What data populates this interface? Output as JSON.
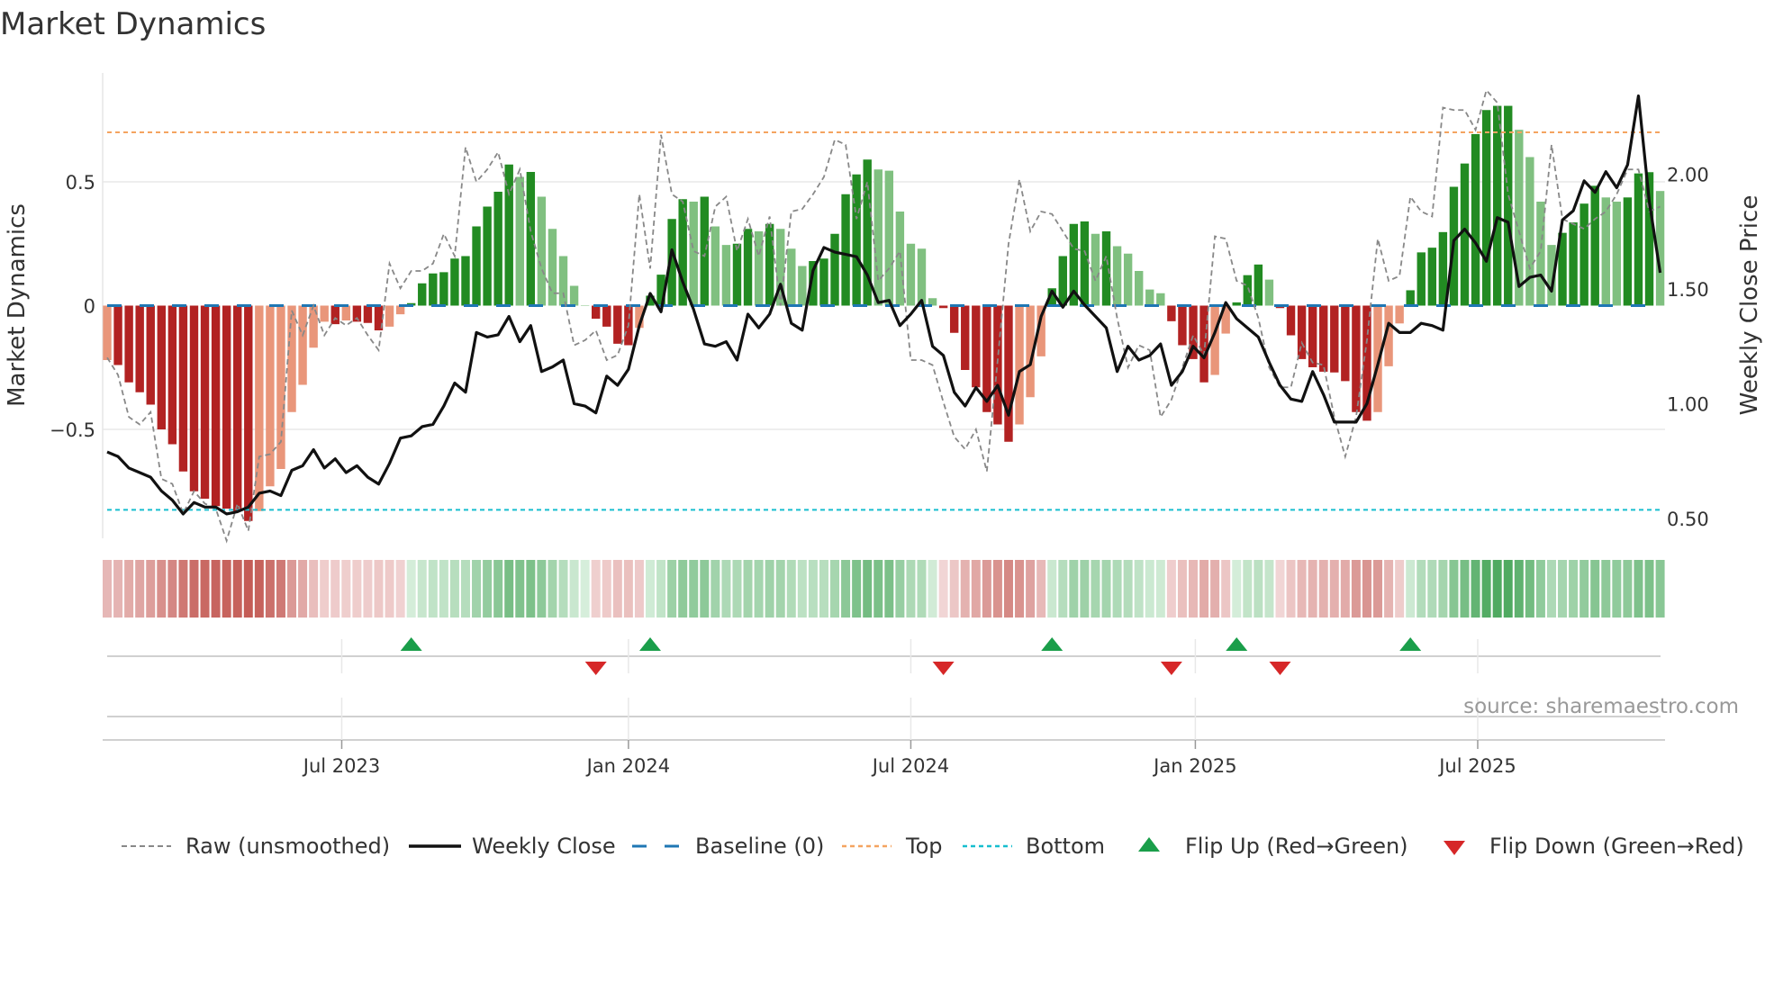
{
  "title": "Market Dynamics",
  "source": "source: sharemaestro.com",
  "colors": {
    "falling_negative": "#b22222",
    "rising_negative": "#e9967a",
    "rising_positive": "#228b22",
    "falling_positive": "#80c080",
    "raw_line": "#888888",
    "close_line": "#111111",
    "baseline": "#1f77b4",
    "top": "#f4a460",
    "bottom": "#17becf",
    "flip_up": "#1a9e4a",
    "flip_down": "#d62728"
  },
  "chart_data": {
    "type": "bar",
    "title": "Market Dynamics",
    "ylabel": "Market Dynamics",
    "y2label": "Weekly Close Price",
    "ylim": [
      -0.94,
      0.94
    ],
    "y2lim": [
      0.414,
      2.44
    ],
    "yticks": [
      {
        "value": 0.5,
        "label": "0.5"
      },
      {
        "value": 0,
        "label": "0"
      },
      {
        "value": -0.5,
        "label": "−0.5"
      }
    ],
    "y2ticks": [
      {
        "value": 2.0,
        "label": "2.00"
      },
      {
        "value": 1.5,
        "label": "1.50"
      },
      {
        "value": 1.0,
        "label": "1.00"
      },
      {
        "value": 0.5,
        "label": "0.50"
      }
    ],
    "xticks": [
      {
        "week": 21.6,
        "label": "Jul 2023"
      },
      {
        "week": 48.0,
        "label": "Jan 2024"
      },
      {
        "week": 74.0,
        "label": "Jul 2024"
      },
      {
        "week": 100.2,
        "label": "Jan 2025"
      },
      {
        "week": 126.2,
        "label": "Jul 2025"
      }
    ],
    "top_level": 0.7,
    "bottom_level": -0.825,
    "baseline": 0,
    "dynamics": [
      -0.22,
      -0.24,
      -0.31,
      -0.35,
      -0.4,
      -0.5,
      -0.56,
      -0.67,
      -0.75,
      -0.78,
      -0.81,
      -0.82,
      -0.83,
      -0.87,
      -0.83,
      -0.73,
      -0.66,
      -0.43,
      -0.32,
      -0.17,
      -0.065,
      -0.075,
      -0.06,
      -0.065,
      -0.07,
      -0.1,
      -0.085,
      -0.035,
      0.01,
      0.09,
      0.13,
      0.135,
      0.19,
      0.2,
      0.32,
      0.4,
      0.46,
      0.57,
      0.52,
      0.54,
      0.44,
      0.31,
      0.2,
      0.08,
      0.0,
      -0.053,
      -0.085,
      -0.154,
      -0.16,
      -0.09,
      0.04,
      0.125,
      0.35,
      0.43,
      0.42,
      0.44,
      0.32,
      0.245,
      0.25,
      0.31,
      0.3,
      0.33,
      0.31,
      0.23,
      0.16,
      0.18,
      0.19,
      0.29,
      0.45,
      0.53,
      0.59,
      0.55,
      0.545,
      0.38,
      0.25,
      0.23,
      0.03,
      -0.01,
      -0.11,
      -0.26,
      -0.33,
      -0.43,
      -0.48,
      -0.55,
      -0.48,
      -0.37,
      -0.205,
      0.07,
      0.2,
      0.33,
      0.34,
      0.29,
      0.3,
      0.24,
      0.21,
      0.14,
      0.065,
      0.05,
      -0.063,
      -0.16,
      -0.216,
      -0.31,
      -0.28,
      -0.113,
      0.013,
      0.123,
      0.166,
      0.105,
      -0.01,
      -0.12,
      -0.216,
      -0.249,
      -0.267,
      -0.27,
      -0.305,
      -0.43,
      -0.465,
      -0.43,
      -0.245,
      -0.072,
      0.062,
      0.215,
      0.234,
      0.297,
      0.48,
      0.574,
      0.693,
      0.79,
      0.807,
      0.807,
      0.71,
      0.6,
      0.42,
      0.245,
      0.294,
      0.336,
      0.412,
      0.484,
      0.437,
      0.42,
      0.437,
      0.534,
      0.539,
      0.463
    ],
    "raw": [
      -0.21,
      -0.28,
      -0.45,
      -0.48,
      -0.43,
      -0.7,
      -0.72,
      -0.84,
      -0.75,
      -0.8,
      -0.82,
      -0.95,
      -0.8,
      -0.91,
      -0.61,
      -0.6,
      -0.55,
      -0.02,
      -0.12,
      0.0,
      -0.12,
      -0.05,
      -0.08,
      -0.05,
      -0.12,
      -0.18,
      0.17,
      0.07,
      0.14,
      0.14,
      0.17,
      0.29,
      0.2,
      0.64,
      0.5,
      0.55,
      0.62,
      0.45,
      0.55,
      0.3,
      0.15,
      0.05,
      0.05,
      -0.16,
      -0.14,
      -0.1,
      -0.22,
      -0.2,
      -0.08,
      0.45,
      0.15,
      0.69,
      0.45,
      0.42,
      0.22,
      0.2,
      0.4,
      0.44,
      0.22,
      0.35,
      0.2,
      0.36,
      0.0,
      0.38,
      0.39,
      0.45,
      0.52,
      0.67,
      0.65,
      0.35,
      0.5,
      0.1,
      0.15,
      0.22,
      -0.22,
      -0.22,
      -0.24,
      -0.39,
      -0.53,
      -0.58,
      -0.5,
      -0.67,
      -0.22,
      0.25,
      0.51,
      0.3,
      0.38,
      0.37,
      0.3,
      0.23,
      0.22,
      0.1,
      0.2,
      -0.05,
      -0.25,
      -0.16,
      -0.18,
      -0.45,
      -0.38,
      -0.25,
      -0.12,
      -0.2,
      0.28,
      0.27,
      0.1,
      0.08,
      -0.05,
      -0.25,
      -0.33,
      -0.33,
      -0.15,
      -0.23,
      -0.24,
      -0.45,
      -0.61,
      -0.45,
      -0.14,
      0.27,
      0.1,
      0.12,
      0.44,
      0.38,
      0.36,
      0.8,
      0.79,
      0.79,
      0.71,
      0.87,
      0.82,
      0.45,
      0.3,
      0.15,
      0.22,
      0.65,
      0.35,
      0.33,
      0.31,
      0.35,
      0.38,
      0.45,
      0.55,
      0.55,
      0.38,
      0.4
    ],
    "close": [
      0.79,
      0.77,
      0.72,
      0.7,
      0.68,
      0.62,
      0.58,
      0.52,
      0.57,
      0.55,
      0.55,
      0.52,
      0.53,
      0.55,
      0.61,
      0.62,
      0.6,
      0.71,
      0.73,
      0.8,
      0.72,
      0.76,
      0.7,
      0.73,
      0.68,
      0.65,
      0.74,
      0.85,
      0.86,
      0.9,
      0.91,
      0.99,
      1.09,
      1.05,
      1.31,
      1.29,
      1.3,
      1.38,
      1.27,
      1.34,
      1.14,
      1.16,
      1.19,
      1.0,
      0.99,
      0.96,
      1.12,
      1.08,
      1.15,
      1.34,
      1.48,
      1.4,
      1.67,
      1.53,
      1.41,
      1.26,
      1.25,
      1.27,
      1.19,
      1.39,
      1.33,
      1.39,
      1.52,
      1.35,
      1.32,
      1.58,
      1.68,
      1.66,
      1.65,
      1.64,
      1.56,
      1.44,
      1.45,
      1.34,
      1.39,
      1.45,
      1.25,
      1.21,
      1.05,
      0.99,
      1.07,
      1.01,
      1.08,
      0.95,
      1.14,
      1.17,
      1.38,
      1.49,
      1.42,
      1.49,
      1.43,
      1.38,
      1.33,
      1.14,
      1.25,
      1.19,
      1.21,
      1.26,
      1.08,
      1.14,
      1.25,
      1.2,
      1.31,
      1.44,
      1.37,
      1.33,
      1.29,
      1.18,
      1.08,
      1.02,
      1.01,
      1.14,
      1.04,
      0.92,
      0.92,
      0.92,
      1.0,
      1.17,
      1.35,
      1.31,
      1.31,
      1.35,
      1.34,
      1.32,
      1.71,
      1.76,
      1.7,
      1.62,
      1.81,
      1.79,
      1.51,
      1.55,
      1.56,
      1.49,
      1.8,
      1.84,
      1.97,
      1.92,
      2.01,
      1.94,
      2.04,
      2.34,
      1.88,
      1.57
    ],
    "flip_up_weeks": [
      28,
      50,
      87,
      104,
      120
    ],
    "flip_down_weeks": [
      45,
      77,
      98,
      108
    ],
    "legend": [
      "Raw (unsmoothed)",
      "Weekly Close",
      "Baseline (0)",
      "Top",
      "Bottom",
      "Flip Up (Red→Green)",
      "Flip Down (Green→Red)"
    ],
    "legend_placement": "bottom"
  }
}
